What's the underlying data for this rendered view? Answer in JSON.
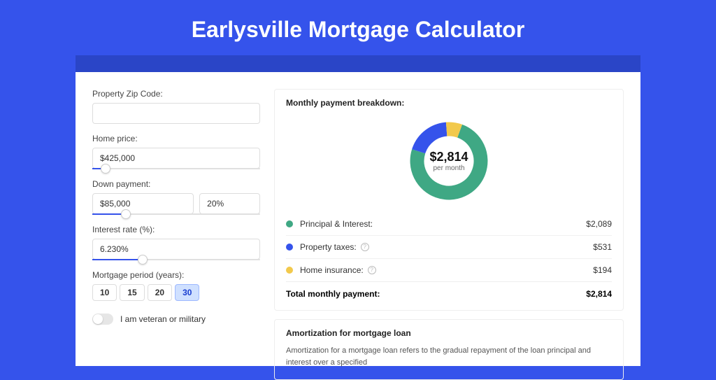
{
  "title": "Earlysville Mortgage Calculator",
  "form": {
    "zip_label": "Property Zip Code:",
    "zip_value": "",
    "home_price_label": "Home price:",
    "home_price_value": "$425,000",
    "home_price_slider_pct": 8,
    "down_payment_label": "Down payment:",
    "down_payment_value": "$85,000",
    "down_payment_pct": "20%",
    "down_payment_slider_pct": 20,
    "interest_label": "Interest rate (%):",
    "interest_value": "6.230%",
    "interest_slider_pct": 30,
    "period_label": "Mortgage period (years):",
    "periods": [
      "10",
      "15",
      "20",
      "30"
    ],
    "period_active": "30",
    "veteran_label": "I am veteran or military"
  },
  "breakdown": {
    "title": "Monthly payment breakdown:",
    "center_value": "$2,814",
    "center_sub": "per month",
    "items": [
      {
        "label": "Principal & Interest:",
        "value": "$2,089",
        "color": "#3fa884",
        "has_info": false
      },
      {
        "label": "Property taxes:",
        "value": "$531",
        "color": "#3553eb",
        "has_info": true
      },
      {
        "label": "Home insurance:",
        "value": "$194",
        "color": "#f2c94c",
        "has_info": true
      }
    ],
    "total_label": "Total monthly payment:",
    "total_value": "$2,814"
  },
  "chart_data": {
    "type": "pie",
    "title": "Monthly payment breakdown",
    "series": [
      {
        "name": "Principal & Interest",
        "value": 2089,
        "color": "#3fa884"
      },
      {
        "name": "Property taxes",
        "value": 531,
        "color": "#3553eb"
      },
      {
        "name": "Home insurance",
        "value": 194,
        "color": "#f2c94c"
      }
    ],
    "total": 2814,
    "center_label": "$2,814 per month"
  },
  "amortization": {
    "title": "Amortization for mortgage loan",
    "body": "Amortization for a mortgage loan refers to the gradual repayment of the loan principal and interest over a specified"
  }
}
